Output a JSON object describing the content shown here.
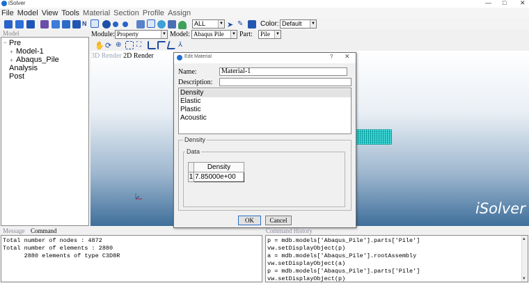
{
  "window": {
    "title": "iSolver",
    "minimize": "—",
    "maximize": "□",
    "close": "✕"
  },
  "menu": [
    "File",
    "Model",
    "View",
    "Tools",
    "Material",
    "Section",
    "Profile",
    "Assign"
  ],
  "toolbar": {
    "filter_value": "ALL",
    "color_label": "Color:",
    "color_value": "Default",
    "module_label": "Module:",
    "module_value": "Property",
    "model_label": "Model:",
    "model_value": "Abaqus Pile",
    "part_label": "Part:",
    "part_value": "Pile"
  },
  "model_panel": {
    "header": "Model",
    "tree": [
      {
        "label": "Pre",
        "level": 0,
        "expander": "−"
      },
      {
        "label": "Model-1",
        "level": 1,
        "expander": "+"
      },
      {
        "label": "Abaqus_Pile",
        "level": 1,
        "expander": "+"
      },
      {
        "label": "Analysis",
        "level": 0,
        "expander": ""
      },
      {
        "label": "Post",
        "level": 0,
        "expander": ""
      }
    ]
  },
  "viewport": {
    "tab_3d": "3D Render",
    "tab_2d": "2D Render",
    "brand": "iSolver"
  },
  "dialog": {
    "title": "Edit Material",
    "help": "?",
    "close": "✕",
    "name_label": "Name:",
    "name_value": "Material-1",
    "description_label": "Description:",
    "description_value": "",
    "behaviors": [
      "Density",
      "Elastic",
      "Plastic",
      "Acoustic"
    ],
    "selected_behavior": "Density",
    "density_group": "Density",
    "data_group": "Data",
    "table": {
      "header": "Density",
      "rows": [
        {
          "index": "1",
          "value": "7.85000e+00"
        }
      ]
    },
    "ok": "OK",
    "cancel": "Cancel"
  },
  "message_panel": {
    "tab_message": "Message",
    "tab_command": "Command",
    "lines": [
      "Total number of nodes : 4872",
      "Total number of elements : 2880",
      "      2880 elements of type C3D8R"
    ]
  },
  "history_panel": {
    "header": "Command History",
    "lines": [
      "p = mdb.models['Abaqus_Pile'].parts['Pile']",
      "vw.setDisplayObject(p)",
      "a = mdb.models['Abaqus_Pile'].rootAssembly",
      "vw.setDisplayObject(a)",
      "p = mdb.models['Abaqus_Pile'].parts['Pile']",
      "vw.setDisplayObject(p)"
    ]
  },
  "colors": {
    "accent": "#1c6fd1",
    "pile": "#2cc9c9",
    "viewport_bottom": "#3f6f9b"
  }
}
